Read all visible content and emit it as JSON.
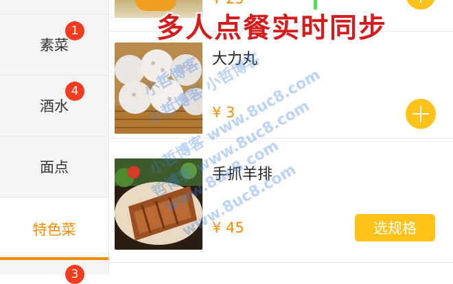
{
  "sidebar": {
    "categories": [
      {
        "label": "素菜",
        "badge": "1"
      },
      {
        "label": "酒水",
        "badge": "4"
      },
      {
        "label": "面点",
        "badge": ""
      },
      {
        "label": "特色菜",
        "badge": ""
      },
      {
        "label": "",
        "badge": "3"
      }
    ],
    "active_index": 3
  },
  "main": {
    "top_partial": {
      "price": "¥ 25"
    },
    "items": [
      {
        "name": "大力丸",
        "price": "¥ 3",
        "action": "plus"
      },
      {
        "name": "手抓羊排",
        "price": "¥ 45",
        "action_label": "选规格"
      }
    ]
  },
  "overlay": {
    "banner": "多人点餐实时同步",
    "watermarks": [
      "小哲博客",
      "小哲博客 小哲博客",
      "小哲博客 www.8uc8.com",
      "哲博客 www.8uc8.com",
      "www.8uc8.com",
      "www.8uc8.com"
    ]
  },
  "colors": {
    "accent": "#ff8a00",
    "button": "#ffc21a",
    "badge": "#f23b1f",
    "banner": "#d41c1c"
  }
}
